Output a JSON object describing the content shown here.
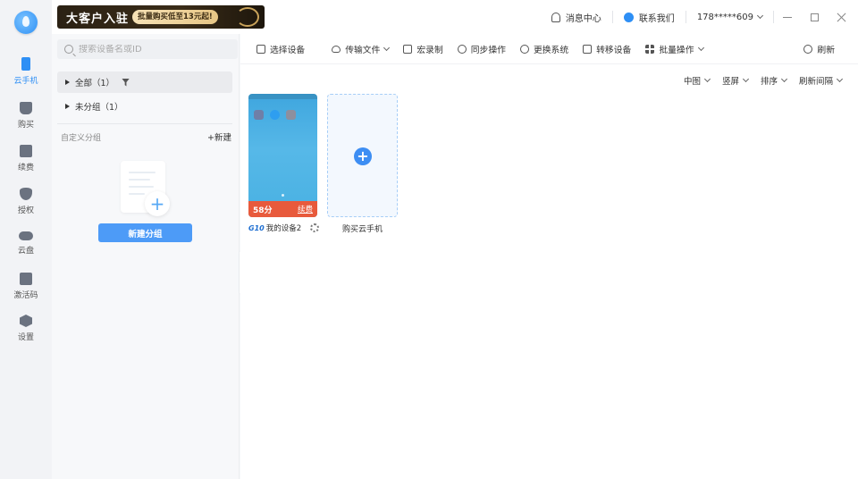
{
  "rail": {
    "items": [
      {
        "label": "云手机",
        "icon": "phone-icon"
      },
      {
        "label": "购买",
        "icon": "cart-icon"
      },
      {
        "label": "续费",
        "icon": "calendar-icon"
      },
      {
        "label": "授权",
        "icon": "shield-icon"
      },
      {
        "label": "云盘",
        "icon": "cloud-icon"
      },
      {
        "label": "激活码",
        "icon": "key-icon"
      },
      {
        "label": "设置",
        "icon": "hexagon-icon"
      }
    ],
    "active": "云手机"
  },
  "banner": {
    "title": "大客户入驻",
    "promo": "批量购买低至13元起!"
  },
  "header": {
    "messages": "消息中心",
    "contact": "联系我们",
    "account": "178*****609"
  },
  "sidebar": {
    "search_placeholder": "搜索设备名或ID",
    "all": "全部（1）",
    "ungrouped": "未分组（1）",
    "custom_title": "自定义分组",
    "new_link": "+新建",
    "new_group_button": "新建分组"
  },
  "toolbar": {
    "select": "选择设备",
    "transfer": "传输文件",
    "macro": "宏录制",
    "sync": "同步操作",
    "change_os": "更换系统",
    "move": "转移设备",
    "batch": "批量操作",
    "refresh": "刷新"
  },
  "viewbar": {
    "size": "中图",
    "orientation": "竖屏",
    "sort": "排序",
    "interval": "刷新间隔"
  },
  "devices": [
    {
      "badge": "G10",
      "name": "我的设备2",
      "time": "58分",
      "renew": "续费"
    }
  ],
  "buy": {
    "label": "购买云手机"
  },
  "colors": {
    "accent": "#2e8ff5",
    "renew_bar": "#e85a3c",
    "button": "#4d9bf7"
  }
}
